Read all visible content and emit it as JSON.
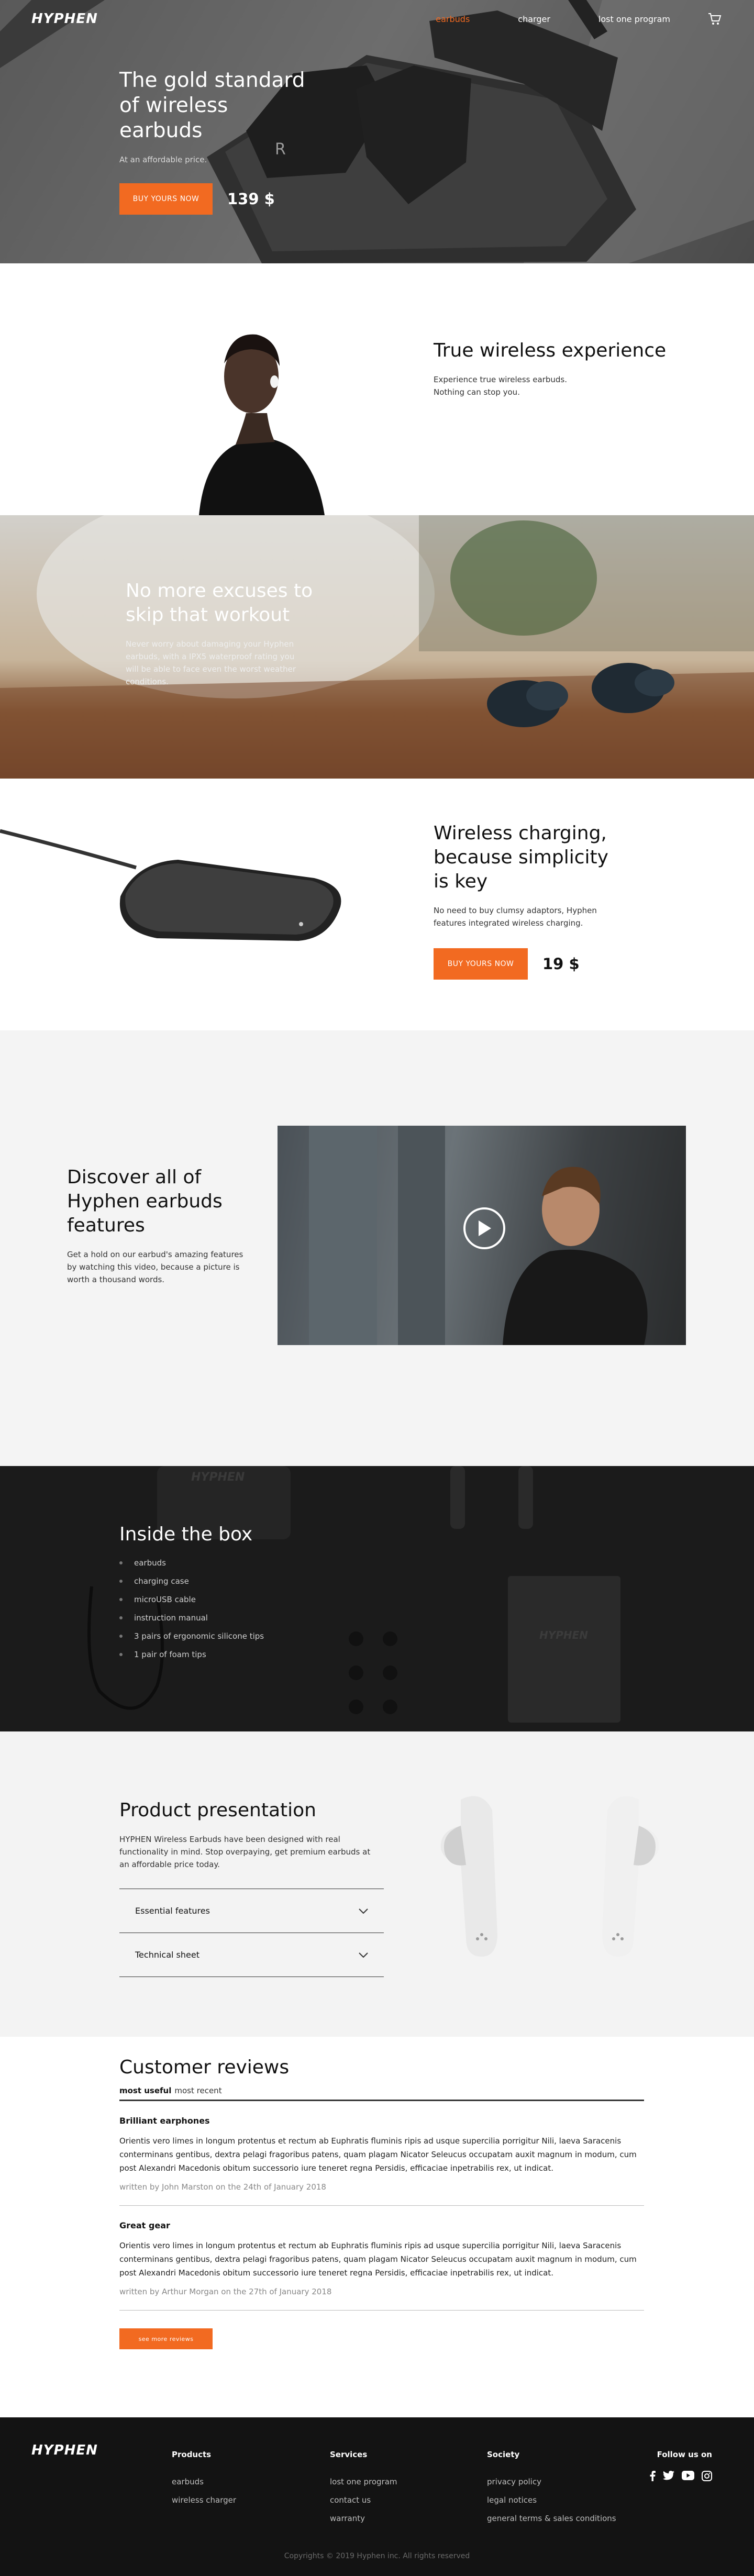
{
  "brand": {
    "logo": "HYPHEN",
    "accent": "#f26a21"
  },
  "nav": {
    "links": [
      "earbuds",
      "charger",
      "lost one program"
    ],
    "active_index": 0,
    "cart_icon": "cart-icon"
  },
  "hero": {
    "title": "The gold standard of wireless earbuds",
    "subtitle": "At an affordable price.",
    "cta": "BUY YOURS NOW",
    "price": "139 $"
  },
  "wireless": {
    "title": "True wireless experience",
    "text": "Experience true wireless earbuds. Nothing can stop you."
  },
  "workout": {
    "title": "No more excuses to skip that workout",
    "text": "Never worry about damaging your Hyphen earbuds, with a IPX5 waterproof rating you will be able to face even the worst weather conditions."
  },
  "charging": {
    "title": "Wireless charging, because simplicity is key",
    "text": "No need to buy clumsy adaptors, Hyphen features integrated wireless charging.",
    "cta": "BUY YOURS NOW",
    "price": "19 $"
  },
  "video": {
    "title": "Discover all of Hyphen earbuds features",
    "text": "Get a hold on our earbud's amazing features by watching this video, because a picture is worth a thousand words.",
    "play_icon": "play-icon"
  },
  "box": {
    "title": "Inside the box",
    "items": [
      "earbuds",
      "charging case",
      "microUSB cable",
      "instruction manual",
      "3 pairs of ergonomic silicone tips",
      "1 pair of foam tips"
    ]
  },
  "presentation": {
    "title": "Product presentation",
    "text": "HYPHEN Wireless Earbuds have been designed with real functionality in mind. Stop overpaying, get premium earbuds at an affordable price today.",
    "accordion": [
      "Essential features",
      "Technical sheet"
    ]
  },
  "reviews": {
    "title": "Customer reviews",
    "sort_active": "most useful",
    "sort_other": "most recent",
    "items": [
      {
        "title": "Brilliant earphones",
        "body": "Orientis vero limes in longum protentus et rectum ab Euphratis fluminis ripis ad usque supercilia porrigitur Nili, laeva Saracenis conterminans gentibus, dextra pelagi fragoribus patens, quam plagam Nicator Seleucus occupatam auxit magnum in modum, cum post Alexandri Macedonis obitum successorio iure teneret regna Persidis, efficaciae inpetrabilis rex, ut indicat.",
        "meta": "written by John Marston on the 24th of January 2018"
      },
      {
        "title": "Great gear",
        "body": "Orientis vero limes in longum protentus et rectum ab Euphratis fluminis ripis ad usque supercilia porrigitur Nili, laeva Saracenis conterminans gentibus, dextra pelagi fragoribus patens, quam plagam Nicator Seleucus occupatam auxit magnum in modum, cum post Alexandri Macedonis obitum successorio iure teneret regna Persidis, efficaciae inpetrabilis rex, ut indicat.",
        "meta": "written by Arthur Morgan on the 27th of January 2018"
      }
    ],
    "more": "see more reviews"
  },
  "footer": {
    "logo": "HYPHEN",
    "columns": [
      {
        "title": "Products",
        "links": [
          "earbuds",
          "wireless charger"
        ]
      },
      {
        "title": "Services",
        "links": [
          "lost one program",
          "contact us",
          "warranty"
        ]
      },
      {
        "title": "Society",
        "links": [
          "privacy policy",
          "legal notices",
          "general terms & sales conditions"
        ]
      }
    ],
    "follow": "Follow us on",
    "social_icons": [
      "facebook-icon",
      "twitter-icon",
      "youtube-icon",
      "instagram-icon"
    ],
    "copyright": "Copyrights © 2019 Hyphen inc. All rights reserved"
  }
}
